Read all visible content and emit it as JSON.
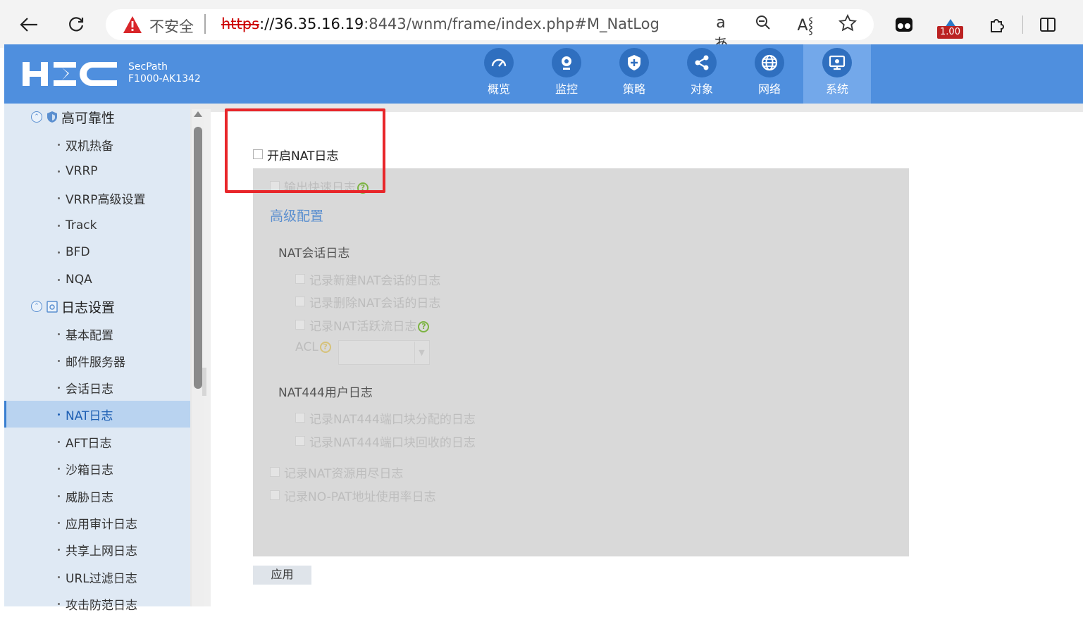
{
  "browser": {
    "insecure_label": "不安全",
    "url_scheme": "https",
    "url_host": "://36.35.16.19",
    "url_rest": ":8443/wnm/frame/index.php#M_NatLog",
    "zoom_badge": "1.00"
  },
  "header": {
    "model_name": "SecPath",
    "model_number": "F1000-AK1342",
    "nav": [
      {
        "label": "概览",
        "icon": "dashboard-icon"
      },
      {
        "label": "监控",
        "icon": "camera-icon"
      },
      {
        "label": "策略",
        "icon": "shield-plus-icon"
      },
      {
        "label": "对象",
        "icon": "share-icon"
      },
      {
        "label": "网络",
        "icon": "globe-icon"
      },
      {
        "label": "系统",
        "icon": "monitor-icon",
        "active": true
      }
    ]
  },
  "sidebar": {
    "group_ha": "高可靠性",
    "ha_items": [
      "双机热备",
      "VRRP",
      "VRRP高级设置",
      "Track",
      "BFD",
      "NQA"
    ],
    "group_log": "日志设置",
    "log_items": [
      "基本配置",
      "邮件服务器",
      "会话日志",
      "NAT日志",
      "AFT日志",
      "沙箱日志",
      "威胁日志",
      "应用审计日志",
      "共享上网日志",
      "URL过滤日志",
      "攻击防范日志"
    ],
    "selected": "NAT日志"
  },
  "form": {
    "enable_nat_log": "开启NAT日志",
    "fast_log": "输出快速日志",
    "advanced": "高级配置",
    "session_log_title": "NAT会话日志",
    "session_new": "记录新建NAT会话的日志",
    "session_delete": "记录删除NAT会话的日志",
    "session_active": "记录NAT活跃流日志",
    "acl_label": "ACL",
    "nat444_title": "NAT444用户日志",
    "nat444_alloc": "记录NAT444端口块分配的日志",
    "nat444_reclaim": "记录NAT444端口块回收的日志",
    "resource_exhausted": "记录NAT资源用尽日志",
    "nopat_usage": "记录NO-PAT地址使用率日志",
    "apply": "应用"
  },
  "colors": {
    "header_bg": "#4f8fde",
    "highlight_box": "#e8262a",
    "sidebar_selected": "#b9d3f0"
  }
}
